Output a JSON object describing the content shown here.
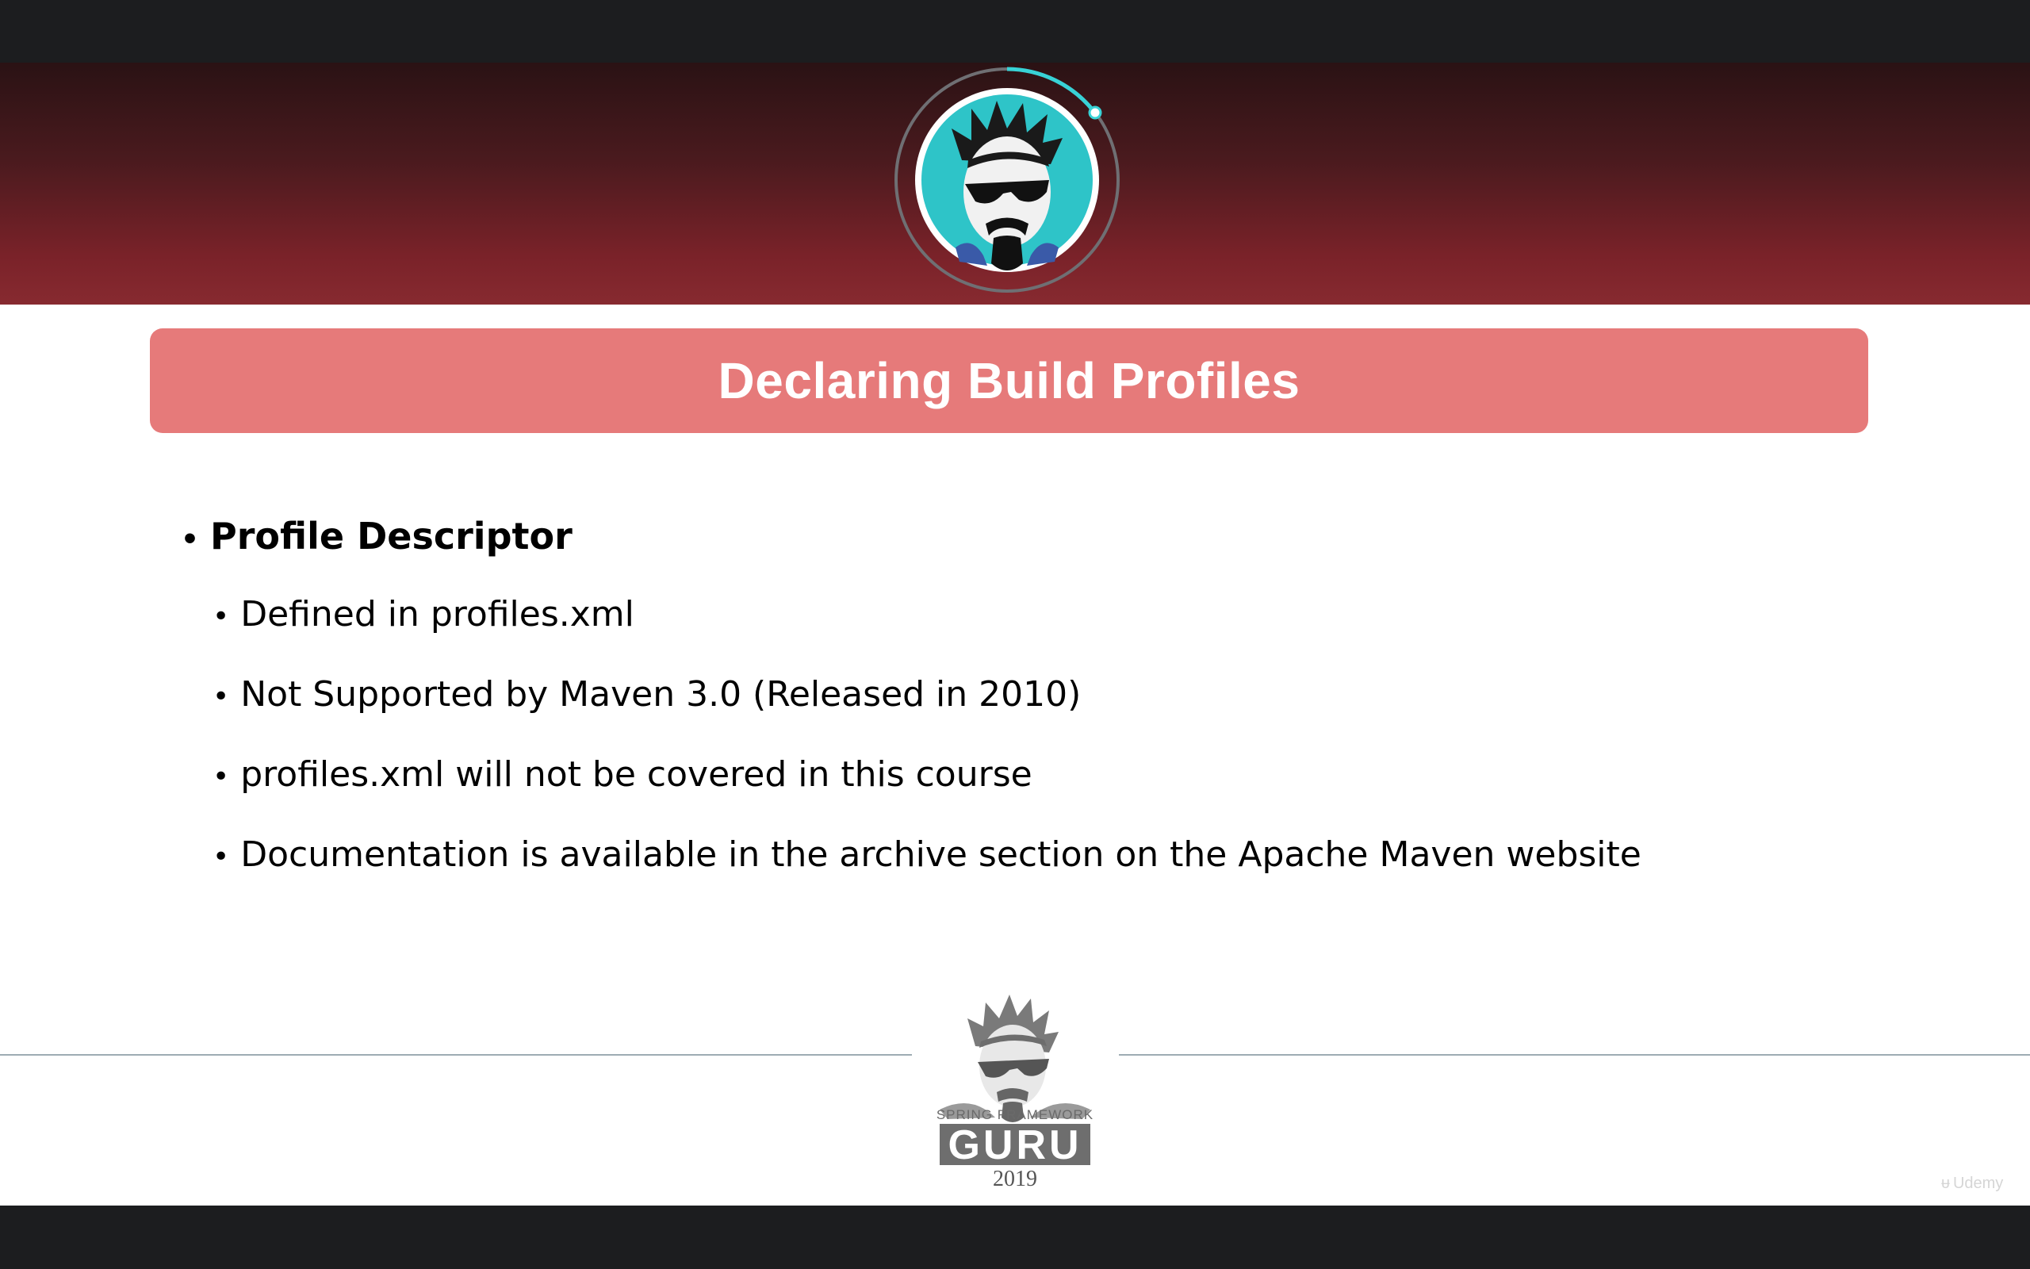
{
  "slide": {
    "title": "Declaring Build Profiles",
    "bullets": [
      {
        "text": "Profile Descriptor",
        "level": 1
      },
      {
        "text": "Defined in profiles.xml",
        "level": 2
      },
      {
        "text": "Not Supported by Maven 3.0 (Released in 2010)",
        "level": 2
      },
      {
        "text": "profiles.xml will not be covered in this course",
        "level": 2
      },
      {
        "text": "Documentation is available in the archive section on the Apache Maven website",
        "level": 2
      }
    ],
    "bullet_glyph": "•",
    "logo": {
      "line1": "SPRING FRAMEWORK",
      "line2": "GURU",
      "year": "2019"
    },
    "watermark": "Udemy",
    "colors": {
      "header_dark": "#2a1214",
      "header_light": "#872a30",
      "title_bar": "#e67a7a",
      "avatar_bg": "#2ec4c8",
      "footer_rule": "#9eacb3"
    }
  }
}
